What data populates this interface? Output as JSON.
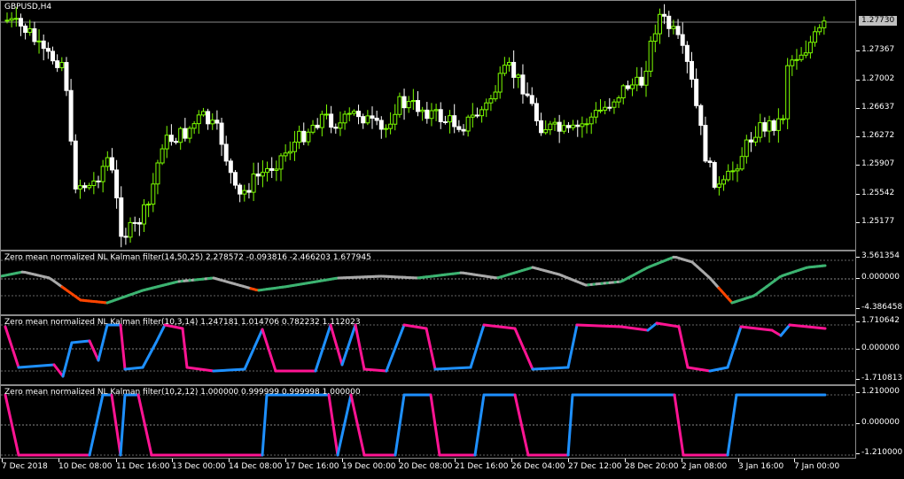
{
  "main_chart": {
    "symbol_label": "GBPUSD,H4",
    "current_price": "1.27730",
    "price_ticks": [
      "1.27367",
      "1.27002",
      "1.26637",
      "1.26272",
      "1.25907",
      "1.25542",
      "1.25177"
    ],
    "colors": {
      "bull": "#7CFC00",
      "bear": "#ffffff",
      "grid": "#8a8a8a"
    }
  },
  "indicator_1": {
    "title": "Zero mean normalized NL Kalman filter(14,50,25) 2.278572 -0.093816 -2.466203 1.677945",
    "ticks": [
      "3.561354",
      "0.000000",
      "-4.386458"
    ],
    "colors": {
      "up": "#3cb371",
      "neutral": "#a9a9a9",
      "down": "#ff4500"
    }
  },
  "indicator_2": {
    "title": "Zero mean normalized NL Kalman filter(10,3,14) 1.247181 1.014706 0.782232 1.112023",
    "ticks": [
      "1.710642",
      "0.000000",
      "-1.710813"
    ],
    "colors": {
      "up": "#1e90ff",
      "down": "#ff1493"
    }
  },
  "indicator_3": {
    "title": "Zero mean normalized NL Kalman filter(10,2,12) 1.000000 0.999999 0.999998 1.000000",
    "ticks": [
      "1.210000",
      "0.000000",
      "-1.210000"
    ],
    "colors": {
      "up": "#1e90ff",
      "down": "#ff1493"
    }
  },
  "time_axis": [
    "7 Dec 2018",
    "10 Dec 08:00",
    "11 Dec 16:00",
    "13 Dec 00:00",
    "14 Dec 08:00",
    "17 Dec 16:00",
    "19 Dec 00:00",
    "20 Dec 08:00",
    "21 Dec 16:00",
    "26 Dec 04:00",
    "27 Dec 12:00",
    "28 Dec 20:00",
    "2 Jan 08:00",
    "3 Jan 16:00",
    "7 Jan 00:00"
  ]
}
